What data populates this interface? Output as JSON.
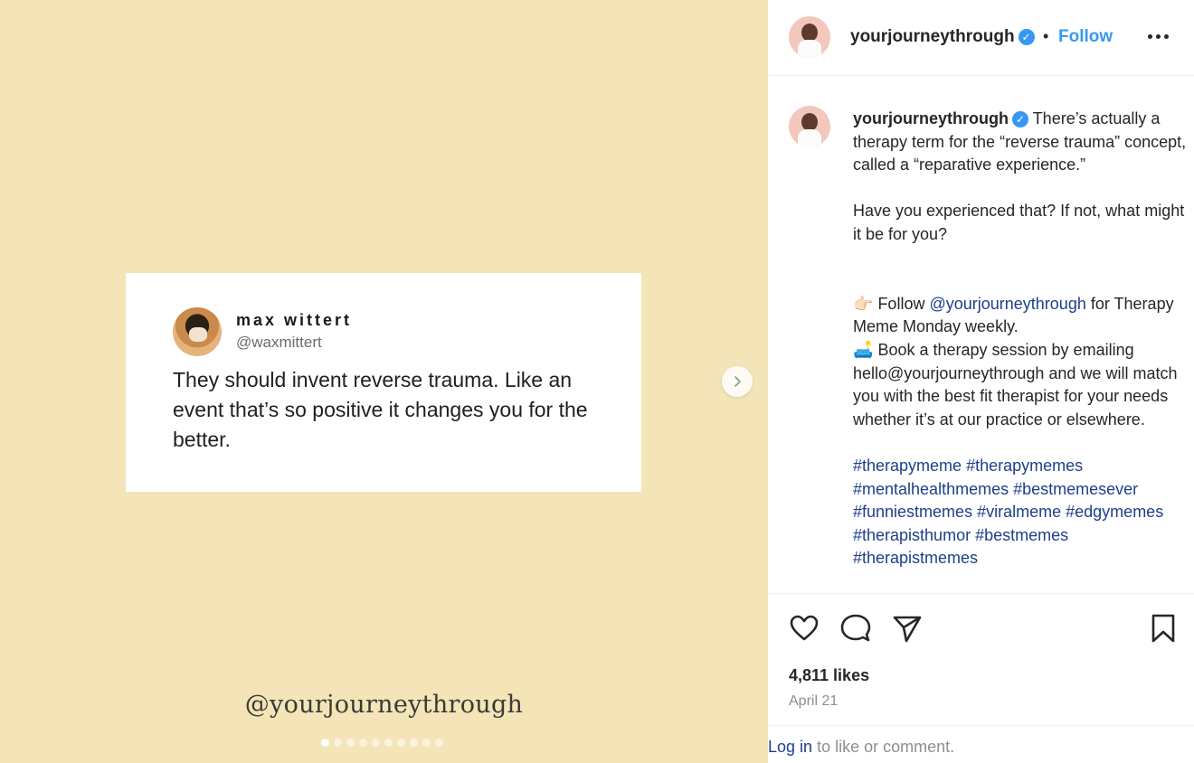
{
  "media": {
    "tweet": {
      "name": "max wittert",
      "handle": "@waxmittert",
      "text": "They should invent reverse trauma. Like an event that’s so positive it changes you for the better."
    },
    "watermark": "@yourjourneythrough",
    "next_icon": "chevron-right-icon",
    "slide_count": 10,
    "active_slide": 1
  },
  "header": {
    "username": "yourjourneythrough",
    "separator": "•",
    "follow_label": "Follow",
    "more_icon": "more-horizontal-icon"
  },
  "caption": {
    "username": "yourjourneythrough",
    "line1": "There’s actually a therapy term for the “reverse trauma” concept, called a “reparative experience.”",
    "line2": "Have you experienced that? If not, what might it be for you?",
    "follow_emoji": "👉🏻",
    "follow_prefix": "Follow",
    "follow_mention": "@yourjourneythrough",
    "follow_suffix": "for Therapy Meme Monday weekly.",
    "book_emoji": "🛋️",
    "book_text": "Book a therapy session by emailing hello@yourjourneythrough and we will match you with the best fit therapist for your needs whether it’s at our practice or elsewhere.",
    "hashtags": [
      "#therapymeme",
      "#therapymemes",
      "#mentalhealthmemes",
      "#bestmemesever",
      "#funniestmemes",
      "#viralmeme",
      "#edgymemes",
      "#therapisthumor",
      "#bestmemes",
      "#therapistmemes"
    ]
  },
  "actions": {
    "likes": "4,811 likes",
    "date": "April 21",
    "icons": [
      "heart-icon",
      "comment-icon",
      "share-icon",
      "bookmark-icon"
    ]
  },
  "login": {
    "link": "Log in",
    "text": "to like or comment."
  },
  "colors": {
    "media_bg": "#f3e5b8",
    "accent": "#3897f0",
    "link": "#1e3f8a"
  }
}
